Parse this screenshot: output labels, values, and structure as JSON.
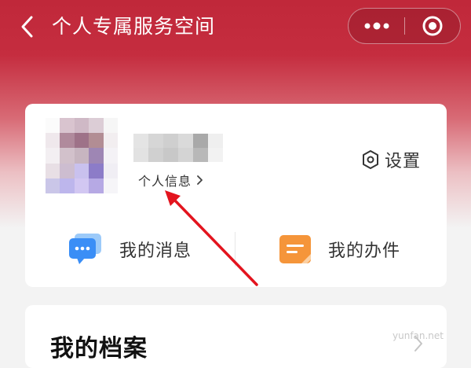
{
  "header": {
    "title": "个人专属服务空间"
  },
  "profile": {
    "info_link": "个人信息",
    "settings_label": "设置"
  },
  "actions": {
    "messages": "我的消息",
    "tasks": "我的办件"
  },
  "archive": {
    "title": "我的档案"
  },
  "watermark": "yunfan.net",
  "colors": {
    "brand_red": "#c0283a",
    "annotation_arrow": "#e3141e",
    "message_icon": "#3a8ef6",
    "task_icon": "#f5953a"
  },
  "icons": {
    "back": "chevron-left-icon",
    "more": "more-dots-icon",
    "close": "target-close-icon",
    "settings": "hexagon-gear-icon",
    "messages": "chat-bubble-icon",
    "tasks": "document-icon"
  }
}
